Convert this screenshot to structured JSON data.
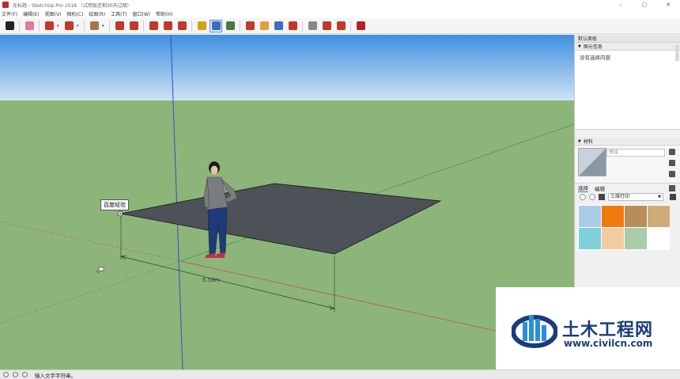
{
  "window": {
    "title": "无标题 - SketchUp Pro 2018 （试用版还剩30天过期）",
    "minimize": "–",
    "maximize": "▢",
    "close": "✕"
  },
  "menu": [
    {
      "label": "文件(F)"
    },
    {
      "label": "编辑(E)"
    },
    {
      "label": "视图(V)"
    },
    {
      "label": "相机(C)"
    },
    {
      "label": "绘图(R)"
    },
    {
      "label": "工具(T)"
    },
    {
      "label": "窗口(W)"
    },
    {
      "label": "帮助(H)"
    }
  ],
  "toolbar": {
    "tools": [
      {
        "name": "select-tool-icon",
        "color": "#222222"
      },
      {
        "name": "eraser-tool-icon",
        "color": "#e07aa0"
      },
      {
        "name": "line-tool-icon",
        "color": "#c0392b"
      },
      {
        "name": "arc-tool-icon",
        "color": "#c0392b"
      },
      {
        "name": "rectangle-tool-icon",
        "color": "#a07850"
      },
      {
        "name": "push-pull-tool-icon",
        "color": "#c0392b"
      },
      {
        "name": "follow-me-tool-icon",
        "color": "#c0392b"
      },
      {
        "name": "move-tool-icon",
        "color": "#c0392b"
      },
      {
        "name": "rotate-tool-icon",
        "color": "#c0392b"
      },
      {
        "name": "scale-tool-icon",
        "color": "#c0392b"
      },
      {
        "name": "tape-measure-tool-icon",
        "color": "#d4a017"
      },
      {
        "name": "text-tool-icon",
        "color": "#3a6ebf"
      },
      {
        "name": "paint-bucket-tool-icon",
        "color": "#4a7a3a"
      },
      {
        "name": "orbit-tool-icon",
        "color": "#c0392b"
      },
      {
        "name": "pan-tool-icon",
        "color": "#e0a040"
      },
      {
        "name": "zoom-tool-icon",
        "color": "#3a6ebf"
      },
      {
        "name": "zoom-extents-tool-icon",
        "color": "#c0392b"
      },
      {
        "name": "warehouse-icon",
        "color": "#888888"
      },
      {
        "name": "extension-warehouse-icon",
        "color": "#c0392b"
      },
      {
        "name": "send-to-layout-icon",
        "color": "#c0392b"
      },
      {
        "name": "ruby-console-icon",
        "color": "#b22222"
      }
    ]
  },
  "viewport": {
    "colors": {
      "sky_top": "#3f8fe0",
      "sky_bottom": "#cfe3f5",
      "ground": "#8db57a",
      "face": "#4d5258",
      "axis_red": "#c05050",
      "axis_green": "#3aa33a",
      "axis_blue": "#3050c0"
    },
    "note_text": "百度经验",
    "dimension_text": "5.58m"
  },
  "tray": {
    "title": "默认面板",
    "entity_info": {
      "title": "图元信息",
      "body": "没有选择内容"
    },
    "materials": {
      "title": "材料",
      "name_placeholder": "预设",
      "tabs": [
        {
          "label": "选择"
        },
        {
          "label": "编辑"
        }
      ],
      "collection": "三维打印",
      "swatches": [
        {
          "color": "#a9cbe8"
        },
        {
          "color": "#f07a10"
        },
        {
          "color": "#b88d5a"
        },
        {
          "color": "#cfab78"
        },
        {
          "color": "#7fd0d8"
        },
        {
          "color": "#f3cba0"
        },
        {
          "color": "#a9ccaa"
        }
      ]
    }
  },
  "status": {
    "text": "输入文字字符串。"
  },
  "watermark": {
    "title": "土木工程网",
    "url": "www.civilcn.com"
  }
}
